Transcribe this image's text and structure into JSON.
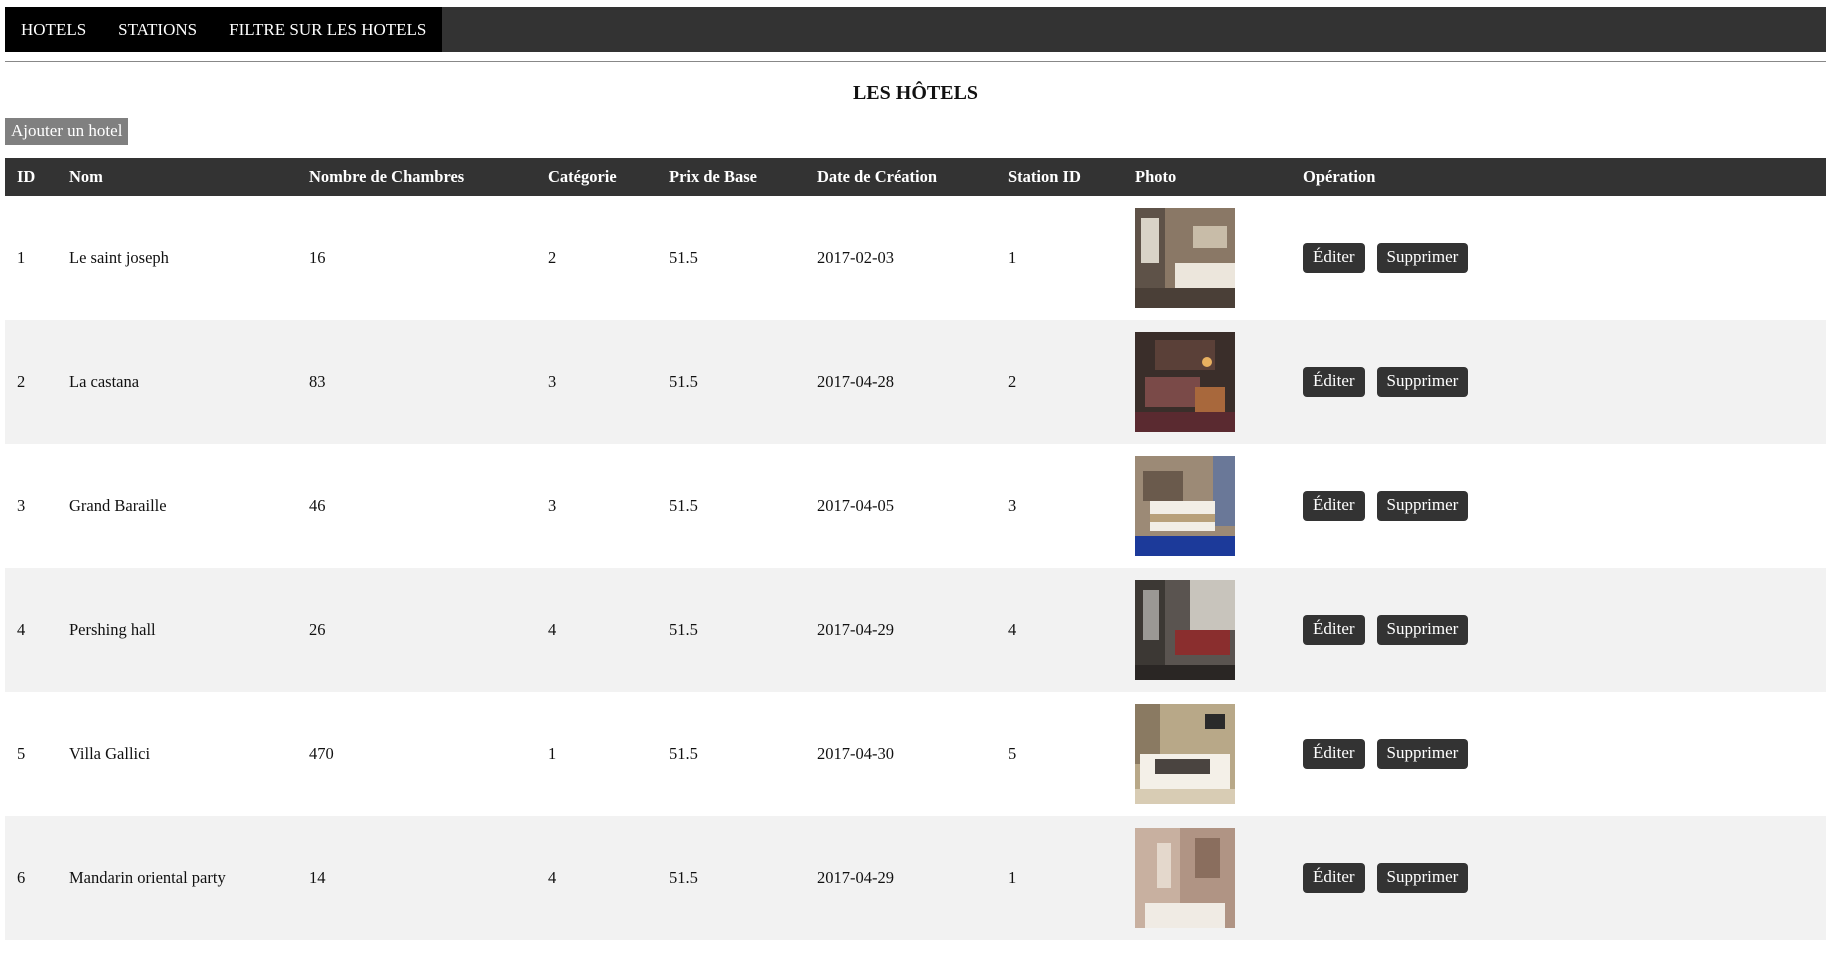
{
  "nav": {
    "items": [
      {
        "label": "HOTELS"
      },
      {
        "label": "STATIONS"
      },
      {
        "label": "FILTRE SUR LES HOTELS"
      }
    ]
  },
  "page": {
    "title": "LES HÔTELS",
    "add_button": "Ajouter un hotel"
  },
  "table": {
    "headers": [
      "ID",
      "Nom",
      "Nombre de Chambres",
      "Catégorie",
      "Prix de Base",
      "Date de Création",
      "Station ID",
      "Photo",
      "Opération"
    ],
    "edit_label": "Éditer",
    "delete_label": "Supprimer",
    "rows": [
      {
        "id": "1",
        "nom": "Le saint joseph",
        "chambres": "16",
        "categorie": "2",
        "prix": "51.5",
        "date": "2017-02-03",
        "station": "1"
      },
      {
        "id": "2",
        "nom": "La castana",
        "chambres": "83",
        "categorie": "3",
        "prix": "51.5",
        "date": "2017-04-28",
        "station": "2"
      },
      {
        "id": "3",
        "nom": "Grand Baraille",
        "chambres": "46",
        "categorie": "3",
        "prix": "51.5",
        "date": "2017-04-05",
        "station": "3"
      },
      {
        "id": "4",
        "nom": "Pershing hall",
        "chambres": "26",
        "categorie": "4",
        "prix": "51.5",
        "date": "2017-04-29",
        "station": "4"
      },
      {
        "id": "5",
        "nom": "Villa Gallici",
        "chambres": "470",
        "categorie": "1",
        "prix": "51.5",
        "date": "2017-04-30",
        "station": "5"
      },
      {
        "id": "6",
        "nom": "Mandarin oriental party",
        "chambres": "14",
        "categorie": "4",
        "prix": "51.5",
        "date": "2017-04-29",
        "station": "1"
      }
    ]
  },
  "colors": {
    "navbar": "#333333",
    "nav_item_bg": "#000000",
    "header_bg": "#333333",
    "alt_row": "#f2f2f2",
    "add_button": "#808080",
    "op_button": "#333333"
  }
}
